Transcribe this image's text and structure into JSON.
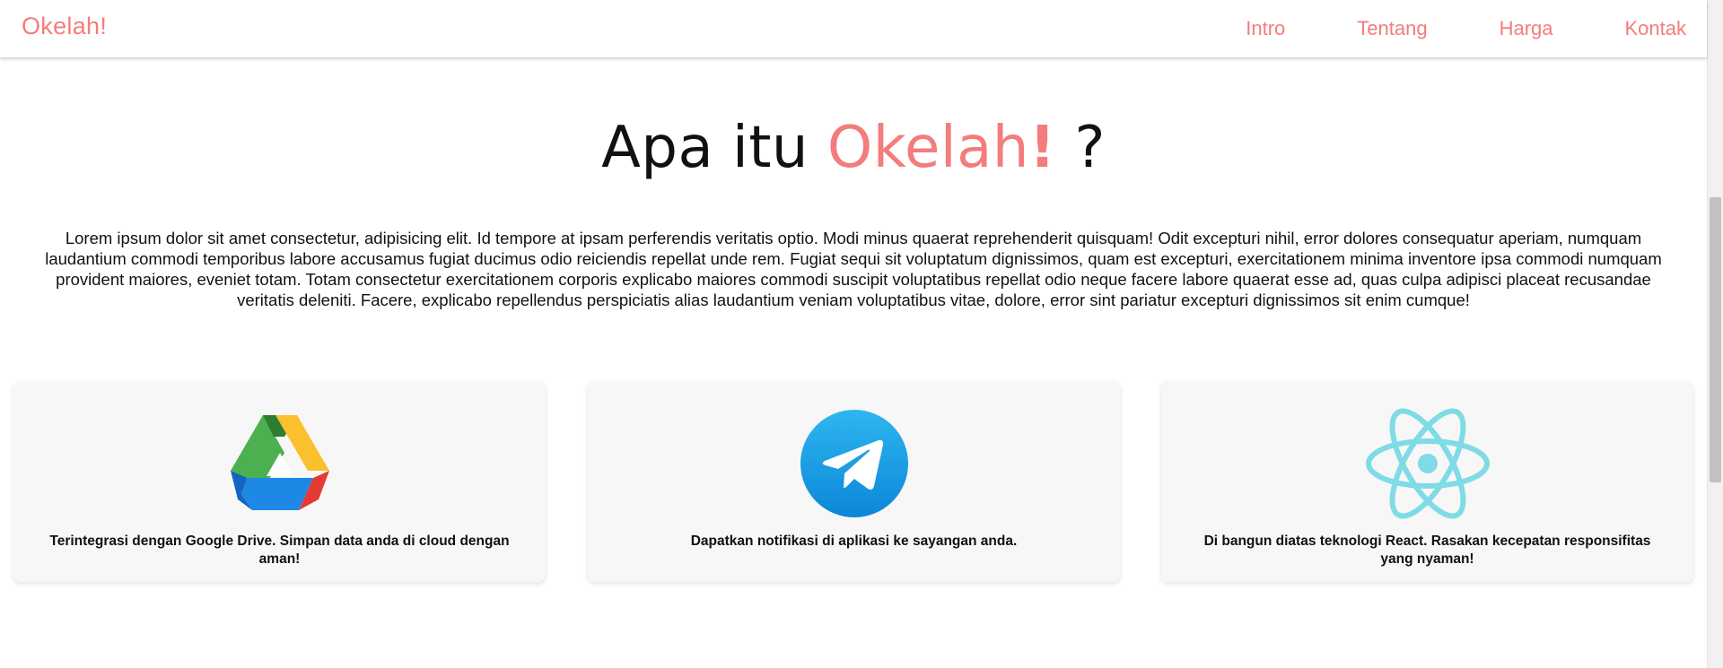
{
  "navbar": {
    "brand": "Okelah!",
    "links": [
      "Intro",
      "Tentang",
      "Harga",
      "Kontak"
    ]
  },
  "about": {
    "heading_prefix": "Apa itu ",
    "heading_brand": "Okelah",
    "heading_exclaim": "!",
    "heading_suffix": " ?",
    "description": "Lorem ipsum dolor sit amet consectetur, adipisicing elit. Id tempore at ipsam perferendis veritatis optio. Modi minus quaerat reprehenderit quisquam! Odit excepturi nihil, error dolores consequatur aperiam, numquam laudantium commodi temporibus labore accusamus fugiat ducimus odio reiciendis repellat unde rem. Fugiat sequi sit voluptatum dignissimos, quam est excepturi, exercitationem minima inventore ipsa commodi numquam provident maiores, eveniet totam. Totam consectetur exercitationem corporis explicabo maiores commodi suscipit voluptatibus repellat odio neque facere labore quaerat esse ad, quas culpa adipisci placeat recusandae veritatis deleniti. Facere, explicabo repellendus perspiciatis alias laudantium veniam voluptatibus vitae, dolore, error sint pariatur excepturi dignissimos sit enim cumque!"
  },
  "features": [
    {
      "icon": "google-drive-icon",
      "caption": "Terintegrasi dengan Google Drive. Simpan data anda di cloud dengan aman!"
    },
    {
      "icon": "telegram-icon",
      "caption": "Dapatkan notifikasi di aplikasi ke sayangan anda."
    },
    {
      "icon": "react-icon",
      "caption": "Di bangun diatas teknologi React. Rasakan kecepatan responsifitas yang nyaman!"
    }
  ],
  "colors": {
    "accent": "#f47c7c",
    "card_bg": "#f7f7f7",
    "text": "#111111"
  }
}
